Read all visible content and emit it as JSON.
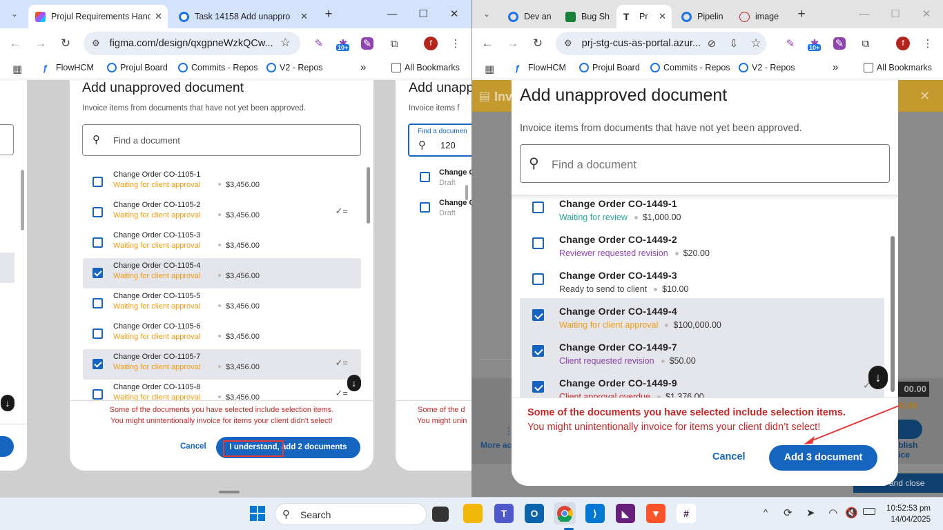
{
  "left_window": {
    "tabs": [
      {
        "title": "Projul Requirements Hand",
        "active": true
      },
      {
        "title": "Task 14158 Add unappro",
        "active": false
      }
    ],
    "url": "figma.com/design/qxgpneWzkQCw...",
    "bookmarks": [
      "FlowHCM",
      "Projul Board",
      "Commits - Repos",
      "V2 - Repos"
    ],
    "all_bookmarks": "All Bookmarks",
    "avatar": "f",
    "ext_badge": "10+",
    "frame_main": {
      "title": "Add unapproved document",
      "subtitle": "Invoice items from documents that have not yet been approved.",
      "search_placeholder": "Find a document",
      "items": [
        {
          "name": "Change Order CO-1105-1",
          "status": "Waiting for client approval",
          "amount": "$3,456.00",
          "checked": false
        },
        {
          "name": "Change Order CO-1105-2",
          "status": "Waiting for client approval",
          "amount": "$3,456.00",
          "checked": false
        },
        {
          "name": "Change Order CO-1105-3",
          "status": "Waiting for client approval",
          "amount": "$3,456.00",
          "checked": false
        },
        {
          "name": "Change Order CO-1105-4",
          "status": "Waiting for client approval",
          "amount": "$3,456.00",
          "checked": true
        },
        {
          "name": "Change Order CO-1105-5",
          "status": "Waiting for client approval",
          "amount": "$3,456.00",
          "checked": false
        },
        {
          "name": "Change Order CO-1105-6",
          "status": "Waiting for client approval",
          "amount": "$3,456.00",
          "checked": false
        },
        {
          "name": "Change Order CO-1105-7",
          "status": "Waiting for client approval",
          "amount": "$3,456.00",
          "checked": true
        },
        {
          "name": "Change Order CO-1105-8",
          "status": "Waiting for client approval",
          "amount": "$3,456.00",
          "checked": false
        }
      ],
      "warning_line1": "Some of the documents you have selected include selection items.",
      "warning_line2": "You might unintentionally invoice for items your client didn't select!",
      "cancel": "Cancel",
      "confirm": "I understand, add 2 documents"
    },
    "frame_second": {
      "title": "Add unapp",
      "subtitle": "Invoice items f",
      "search_label": "Find a documen",
      "search_value": "120",
      "items": [
        {
          "name": "Change O",
          "status": "Draft"
        },
        {
          "name": "Change O",
          "status": "Draft"
        }
      ],
      "warning_line1": "Some of the d",
      "warning_line2": "You might unin"
    }
  },
  "right_window": {
    "tabs": [
      {
        "title": "Dev an"
      },
      {
        "title": "Bug Sh"
      },
      {
        "title": "Pr",
        "active": true
      },
      {
        "title": "Pipelin"
      },
      {
        "title": "image"
      }
    ],
    "url": "prj-stg-cus-as-portal.azur...",
    "bookmarks": [
      "FlowHCM",
      "Projul Board",
      "Commits - Repos",
      "V2 - Repos"
    ],
    "all_bookmarks": "All Bookmarks",
    "avatar": "f",
    "ext_badge": "10+",
    "behind": {
      "header": "Inv",
      "amount1": "00.00",
      "amount2": "00.00",
      "more_actions": "More ac",
      "publish_line1": "ublish",
      "publish_line2": "oice",
      "save_close": "e and close"
    },
    "modal": {
      "title": "Add unapproved document",
      "subtitle": "Invoice items from documents that have not yet been approved.",
      "search_placeholder": "Find a document",
      "items": [
        {
          "name": "Change Order CO-1449-1",
          "status": "Waiting for review",
          "status_color": "#26a69a",
          "amount": "$1,000.00",
          "checked": false
        },
        {
          "name": "Change Order CO-1449-2",
          "status": "Reviewer requested revision",
          "status_color": "#8e44ad",
          "amount": "$20.00",
          "checked": false
        },
        {
          "name": "Change Order CO-1449-3",
          "status": "Ready to send to client",
          "status_color": "#444444",
          "amount": "$10.00",
          "checked": false
        },
        {
          "name": "Change Order CO-1449-4",
          "status": "Waiting for client approval",
          "status_color": "#f39c12",
          "amount": "$100,000.00",
          "checked": true
        },
        {
          "name": "Change Order CO-1449-7",
          "status": "Client requested revision",
          "status_color": "#8e44ad",
          "amount": "$50.00",
          "checked": true
        },
        {
          "name": "Change Order CO-1449-9",
          "status": "Client approval overdue",
          "status_color": "#c62828",
          "amount": "$1,376.00",
          "checked": true
        }
      ],
      "warning_title": "Some of the documents you have selected include selection items.",
      "warning_body": "You might unintentionally invoice for items your client didn’t select!",
      "cancel": "Cancel",
      "confirm": "Add 3 document"
    }
  },
  "taskbar": {
    "search": "Search",
    "time": "10:52:53 pm",
    "date": "14/04/2025"
  },
  "colors": {
    "accent": "#1565c0",
    "warning": "#c62828",
    "orange": "#f39c12",
    "header_orange": "#c49a2f"
  }
}
